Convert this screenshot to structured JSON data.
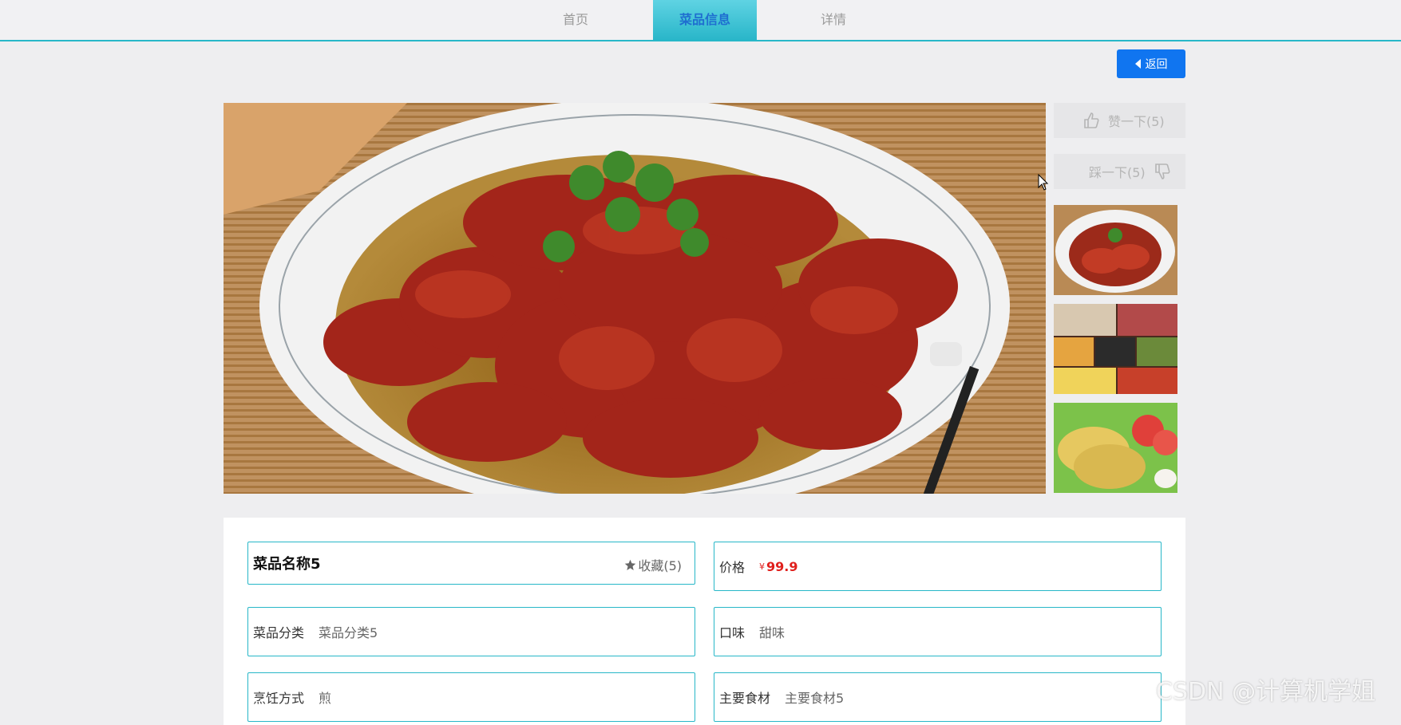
{
  "nav": {
    "home": "首页",
    "info": "菜品信息",
    "detail": "详情"
  },
  "back_label": "返回",
  "votes": {
    "like_label": "赞一下(5)",
    "dislike_label": "踩一下(5)"
  },
  "dish": {
    "name": "菜品名称5",
    "favorite_label": "收藏(5)",
    "price_label": "价格",
    "price_symbol": "¥",
    "price_value": "99.9",
    "category_label": "菜品分类",
    "category_value": "菜品分类5",
    "taste_label": "口味",
    "taste_value": "甜味",
    "cook_label": "烹饪方式",
    "cook_value": "煎",
    "ingredient_label": "主要食材",
    "ingredient_value": "主要食材5"
  },
  "watermark": "CSDN @计算机学姐",
  "colors": {
    "accent": "#27b7c8",
    "button": "#1075f0",
    "price": "#e0201d"
  },
  "icons": [
    "thumbs-up-icon",
    "thumbs-down-icon",
    "star-icon",
    "back-caret-icon"
  ]
}
